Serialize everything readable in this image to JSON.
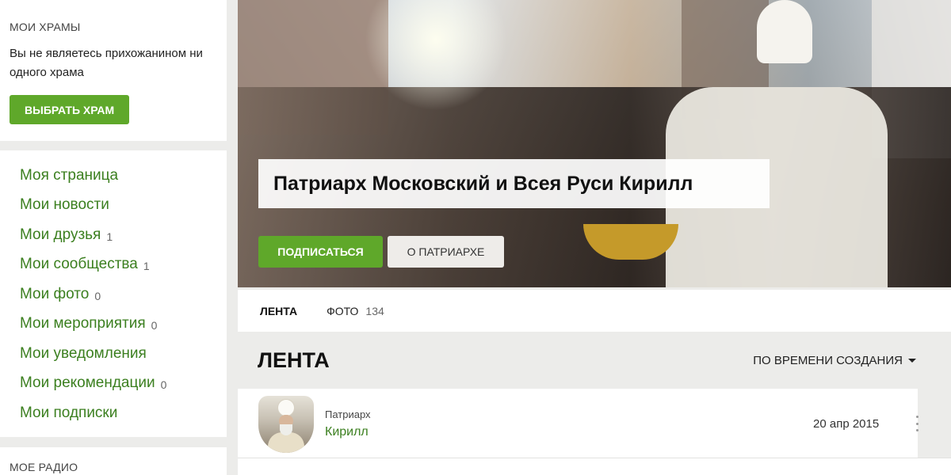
{
  "colors": {
    "accent": "#5fa82a",
    "link": "#3b7f1f",
    "background": "#ececea"
  },
  "temples": {
    "title": "МОИ ХРАМЫ",
    "text": "Вы не являетесь прихожанином ни одного храма",
    "choose_button": "ВЫБРАТЬ ХРАМ"
  },
  "nav": {
    "items": [
      {
        "label": "Моя страница",
        "count": ""
      },
      {
        "label": "Мои новости",
        "count": ""
      },
      {
        "label": "Мои друзья",
        "count": "1"
      },
      {
        "label": "Мои сообщества",
        "count": "1"
      },
      {
        "label": "Мои фото",
        "count": "0"
      },
      {
        "label": "Мои мероприятия",
        "count": "0"
      },
      {
        "label": "Мои уведомления",
        "count": ""
      },
      {
        "label": "Мои рекомендации",
        "count": "0"
      },
      {
        "label": "Мои подписки",
        "count": ""
      }
    ]
  },
  "radio": {
    "title": "МОЕ РАДИО"
  },
  "profile": {
    "title": "Патриарх Московский и Всея Руси Кирилл",
    "subscribe_button": "ПОДПИСАТЬСЯ",
    "about_button": "О ПАТРИАРХЕ"
  },
  "tabs": [
    {
      "label": "ЛЕНТА",
      "count": ""
    },
    {
      "label": "ФОТО",
      "count": "134"
    }
  ],
  "feed": {
    "title": "ЛЕНТА",
    "sort_label": "ПО ВРЕМЕНИ СОЗДАНИЯ"
  },
  "post": {
    "author_top": "Патриарх",
    "author_name": "Кирилл",
    "date": "20 апр 2015"
  }
}
